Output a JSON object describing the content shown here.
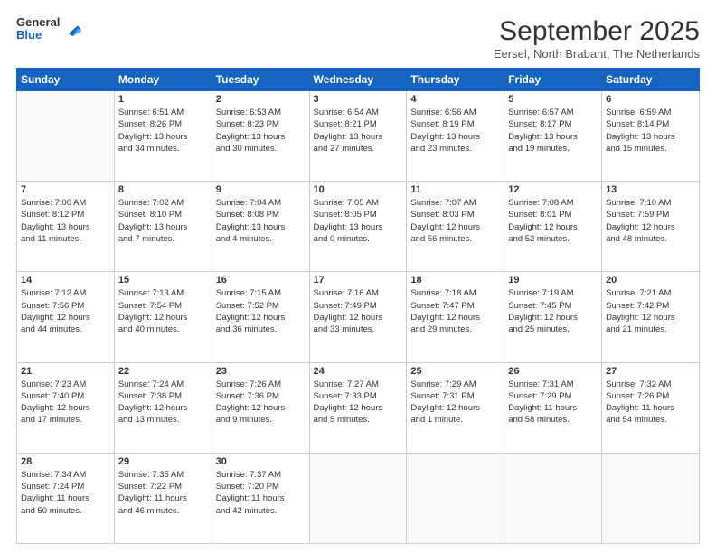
{
  "logo": {
    "line1": "General",
    "line2": "Blue"
  },
  "header": {
    "month": "September 2025",
    "location": "Eersel, North Brabant, The Netherlands"
  },
  "weekdays": [
    "Sunday",
    "Monday",
    "Tuesday",
    "Wednesday",
    "Thursday",
    "Friday",
    "Saturday"
  ],
  "weeks": [
    [
      {
        "day": "",
        "content": ""
      },
      {
        "day": "1",
        "content": "Sunrise: 6:51 AM\nSunset: 8:26 PM\nDaylight: 13 hours\nand 34 minutes."
      },
      {
        "day": "2",
        "content": "Sunrise: 6:53 AM\nSunset: 8:23 PM\nDaylight: 13 hours\nand 30 minutes."
      },
      {
        "day": "3",
        "content": "Sunrise: 6:54 AM\nSunset: 8:21 PM\nDaylight: 13 hours\nand 27 minutes."
      },
      {
        "day": "4",
        "content": "Sunrise: 6:56 AM\nSunset: 8:19 PM\nDaylight: 13 hours\nand 23 minutes."
      },
      {
        "day": "5",
        "content": "Sunrise: 6:57 AM\nSunset: 8:17 PM\nDaylight: 13 hours\nand 19 minutes."
      },
      {
        "day": "6",
        "content": "Sunrise: 6:59 AM\nSunset: 8:14 PM\nDaylight: 13 hours\nand 15 minutes."
      }
    ],
    [
      {
        "day": "7",
        "content": "Sunrise: 7:00 AM\nSunset: 8:12 PM\nDaylight: 13 hours\nand 11 minutes."
      },
      {
        "day": "8",
        "content": "Sunrise: 7:02 AM\nSunset: 8:10 PM\nDaylight: 13 hours\nand 7 minutes."
      },
      {
        "day": "9",
        "content": "Sunrise: 7:04 AM\nSunset: 8:08 PM\nDaylight: 13 hours\nand 4 minutes."
      },
      {
        "day": "10",
        "content": "Sunrise: 7:05 AM\nSunset: 8:05 PM\nDaylight: 13 hours\nand 0 minutes."
      },
      {
        "day": "11",
        "content": "Sunrise: 7:07 AM\nSunset: 8:03 PM\nDaylight: 12 hours\nand 56 minutes."
      },
      {
        "day": "12",
        "content": "Sunrise: 7:08 AM\nSunset: 8:01 PM\nDaylight: 12 hours\nand 52 minutes."
      },
      {
        "day": "13",
        "content": "Sunrise: 7:10 AM\nSunset: 7:59 PM\nDaylight: 12 hours\nand 48 minutes."
      }
    ],
    [
      {
        "day": "14",
        "content": "Sunrise: 7:12 AM\nSunset: 7:56 PM\nDaylight: 12 hours\nand 44 minutes."
      },
      {
        "day": "15",
        "content": "Sunrise: 7:13 AM\nSunset: 7:54 PM\nDaylight: 12 hours\nand 40 minutes."
      },
      {
        "day": "16",
        "content": "Sunrise: 7:15 AM\nSunset: 7:52 PM\nDaylight: 12 hours\nand 36 minutes."
      },
      {
        "day": "17",
        "content": "Sunrise: 7:16 AM\nSunset: 7:49 PM\nDaylight: 12 hours\nand 33 minutes."
      },
      {
        "day": "18",
        "content": "Sunrise: 7:18 AM\nSunset: 7:47 PM\nDaylight: 12 hours\nand 29 minutes."
      },
      {
        "day": "19",
        "content": "Sunrise: 7:19 AM\nSunset: 7:45 PM\nDaylight: 12 hours\nand 25 minutes."
      },
      {
        "day": "20",
        "content": "Sunrise: 7:21 AM\nSunset: 7:42 PM\nDaylight: 12 hours\nand 21 minutes."
      }
    ],
    [
      {
        "day": "21",
        "content": "Sunrise: 7:23 AM\nSunset: 7:40 PM\nDaylight: 12 hours\nand 17 minutes."
      },
      {
        "day": "22",
        "content": "Sunrise: 7:24 AM\nSunset: 7:38 PM\nDaylight: 12 hours\nand 13 minutes."
      },
      {
        "day": "23",
        "content": "Sunrise: 7:26 AM\nSunset: 7:36 PM\nDaylight: 12 hours\nand 9 minutes."
      },
      {
        "day": "24",
        "content": "Sunrise: 7:27 AM\nSunset: 7:33 PM\nDaylight: 12 hours\nand 5 minutes."
      },
      {
        "day": "25",
        "content": "Sunrise: 7:29 AM\nSunset: 7:31 PM\nDaylight: 12 hours\nand 1 minute."
      },
      {
        "day": "26",
        "content": "Sunrise: 7:31 AM\nSunset: 7:29 PM\nDaylight: 11 hours\nand 58 minutes."
      },
      {
        "day": "27",
        "content": "Sunrise: 7:32 AM\nSunset: 7:26 PM\nDaylight: 11 hours\nand 54 minutes."
      }
    ],
    [
      {
        "day": "28",
        "content": "Sunrise: 7:34 AM\nSunset: 7:24 PM\nDaylight: 11 hours\nand 50 minutes."
      },
      {
        "day": "29",
        "content": "Sunrise: 7:35 AM\nSunset: 7:22 PM\nDaylight: 11 hours\nand 46 minutes."
      },
      {
        "day": "30",
        "content": "Sunrise: 7:37 AM\nSunset: 7:20 PM\nDaylight: 11 hours\nand 42 minutes."
      },
      {
        "day": "",
        "content": ""
      },
      {
        "day": "",
        "content": ""
      },
      {
        "day": "",
        "content": ""
      },
      {
        "day": "",
        "content": ""
      }
    ]
  ]
}
